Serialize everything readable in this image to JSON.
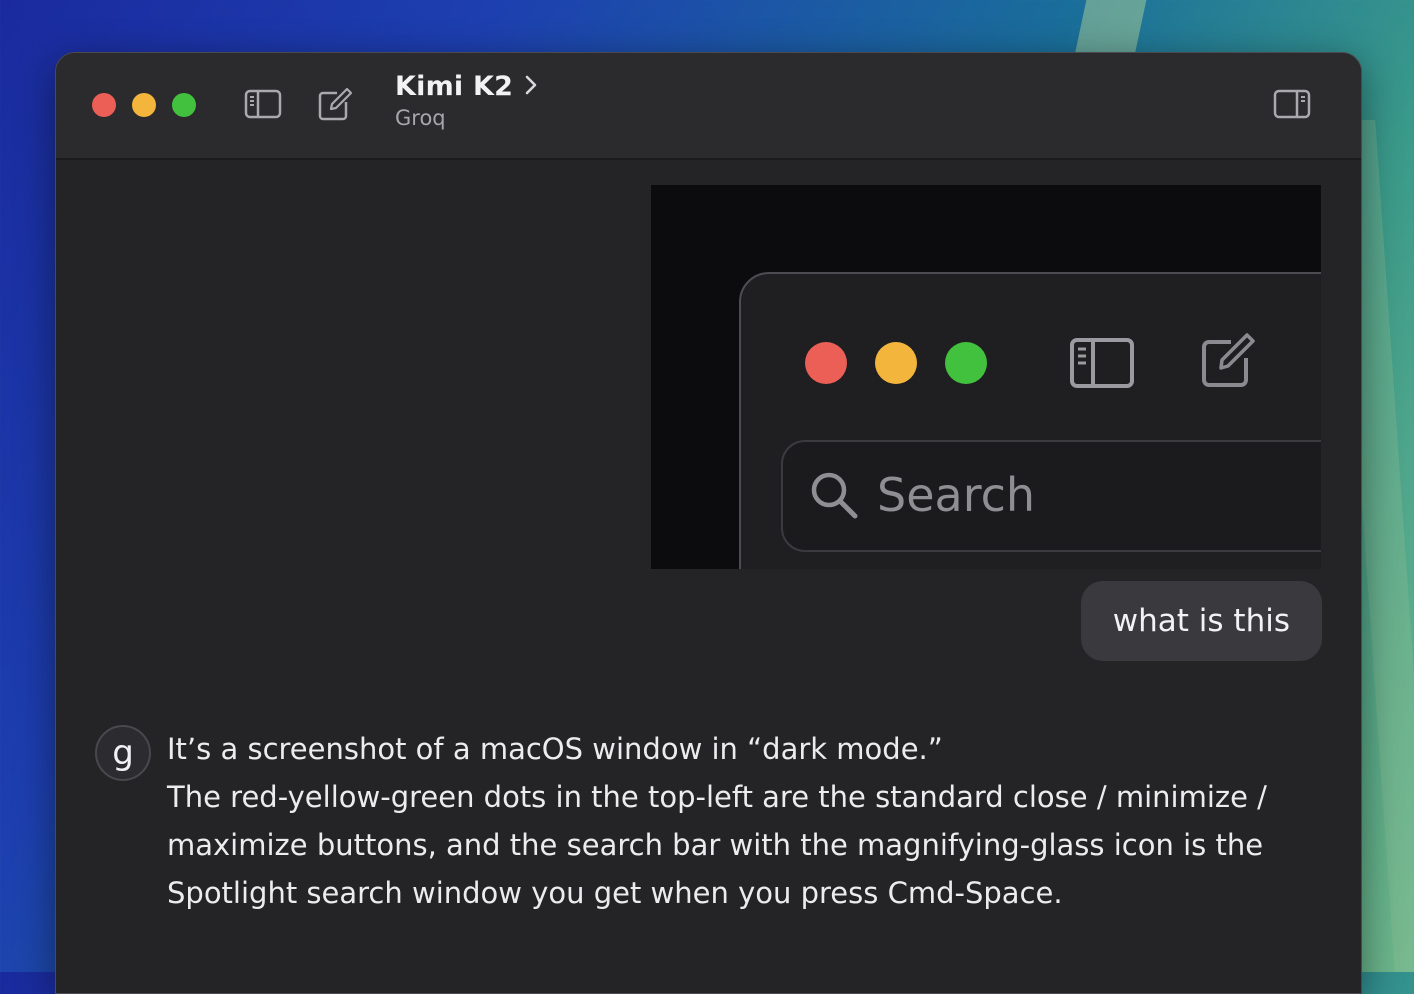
{
  "window": {
    "title": "Kimi K2",
    "subtitle": "Groq",
    "icons": [
      "close-light",
      "minimize-light",
      "maximize-light",
      "sidebar-toggle-icon",
      "compose-icon",
      "chevron-right-icon",
      "right-panel-icon"
    ]
  },
  "colors": {
    "close": "#ec5f56",
    "minimize": "#f4b53c",
    "maximize": "#42c13e",
    "window_bg": "#242427",
    "bubble_bg": "#3a3a3e"
  },
  "chat": {
    "attachment": {
      "search_placeholder": "Search",
      "icons": [
        "close-light",
        "minimize-light",
        "maximize-light",
        "sidebar-toggle-icon",
        "compose-icon",
        "magnifying-glass-icon"
      ]
    },
    "user_message": "what is this",
    "assistant": {
      "avatar_letter": "g",
      "lines": [
        "It’s a screenshot of a macOS window in “dark mode.”",
        "The red-yellow-green dots in the top-left are the standard close / minimize / maximize buttons, and the search bar with the magnifying-glass icon is the Spotlight search window you get when you press Cmd-Space."
      ]
    }
  }
}
